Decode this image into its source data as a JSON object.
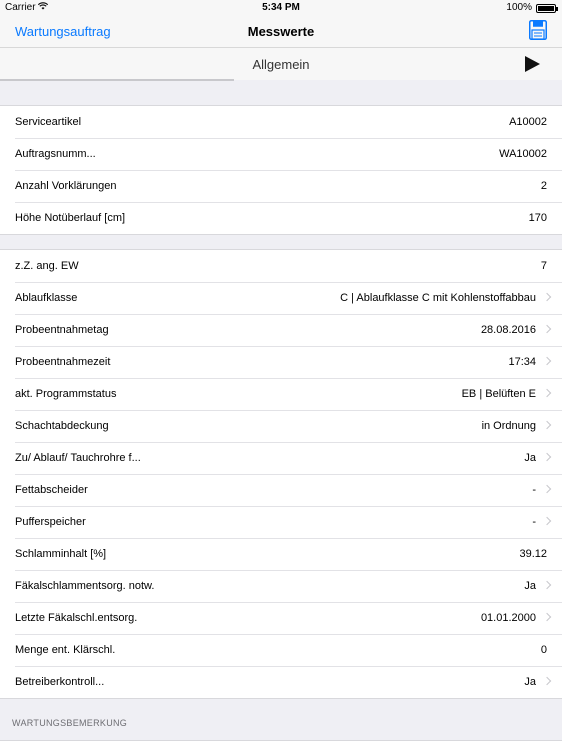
{
  "status": {
    "carrier": "Carrier",
    "time": "5:34 PM",
    "battery": "100%"
  },
  "nav": {
    "back": "Wartungsauftrag",
    "title": "Messwerte",
    "save_icon": "save-icon"
  },
  "segment": {
    "label": "Allgemein",
    "next_icon": "play-icon"
  },
  "group1": [
    {
      "label": "Serviceartikel",
      "value": "A10002"
    },
    {
      "label": "Auftragsnumm...",
      "value": "WA10002"
    },
    {
      "label": "Anzahl Vorklärungen",
      "value": "2"
    },
    {
      "label": "Höhe Notüberlauf [cm]",
      "value": "170"
    }
  ],
  "group2": [
    {
      "label": "z.Z. ang. EW",
      "value": "7"
    },
    {
      "label": "Ablaufklasse",
      "value": "C | Ablaufklasse C mit Kohlenstoffabbau"
    },
    {
      "label": "Probeentnahmetag",
      "value": "28.08.2016"
    },
    {
      "label": "Probeentnahmezeit",
      "value": "17:34"
    },
    {
      "label": "akt. Programmstatus",
      "value": "EB | Belüften E"
    },
    {
      "label": "Schachtabdeckung",
      "value": "in Ordnung"
    },
    {
      "label": "Zu/ Ablauf/ Tauchrohre f...",
      "value": "Ja"
    },
    {
      "label": "Fettabscheider",
      "value": "-"
    },
    {
      "label": "Pufferspeicher",
      "value": "-"
    },
    {
      "label": "Schlamminhalt [%]",
      "value": "39.12"
    },
    {
      "label": "Fäkalschlammentsorg. notw.",
      "value": "Ja"
    },
    {
      "label": "Letzte Fäkalschl.entsorg.",
      "value": "01.01.2000"
    },
    {
      "label": "Menge ent. Klärschl.",
      "value": "0"
    },
    {
      "label": "Betreiberkontroll...",
      "value": "Ja"
    }
  ],
  "section_header": "WARTUNGSBEMERKUNG"
}
